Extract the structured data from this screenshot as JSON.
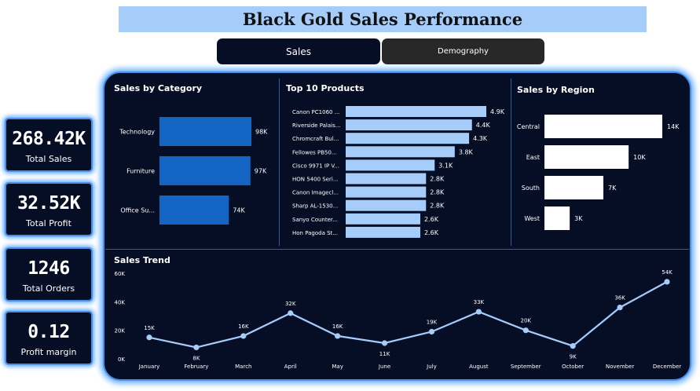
{
  "title": "Black Gold Sales Performance",
  "tabs": {
    "sales": "Sales",
    "demography": "Demography"
  },
  "kpis": [
    {
      "value": "268.42K",
      "label": "Total Sales"
    },
    {
      "value": "32.52K",
      "label": "Total Profit"
    },
    {
      "value": "1246",
      "label": "Total Orders"
    },
    {
      "value": "0.12",
      "label": "Profit margin"
    }
  ],
  "colors": {
    "category_bar": "#1464c4",
    "product_bar": "#a6ccfa",
    "region_bar": "#ffffff",
    "trend_line": "#a6ccfa",
    "panel_bg": "#060e25"
  },
  "chart_data": [
    {
      "type": "bar",
      "title": "Sales by Category",
      "orientation": "horizontal",
      "categories": [
        "Technology",
        "Furniture",
        "Office Su..."
      ],
      "values": [
        98,
        97,
        74
      ],
      "value_labels": [
        "98K",
        "97K",
        "74K"
      ]
    },
    {
      "type": "bar",
      "title": "Top 10 Products",
      "orientation": "horizontal",
      "categories": [
        "Canon PC1060 ...",
        "Riverside Palais...",
        "Chromcraft Bul...",
        "Fellowes PB50...",
        "Cisco 9971 IP V...",
        "HON 5400 Seri...",
        "Canon Imagecl...",
        "Sharp AL-1530...",
        "Sanyo Counter...",
        "Hon Pagoda St..."
      ],
      "values": [
        4.9,
        4.4,
        4.3,
        3.8,
        3.1,
        2.8,
        2.8,
        2.8,
        2.6,
        2.6
      ],
      "value_labels": [
        "4.9K",
        "4.4K",
        "4.3K",
        "3.8K",
        "3.1K",
        "2.8K",
        "2.8K",
        "2.8K",
        "2.6K",
        "2.6K"
      ]
    },
    {
      "type": "bar",
      "title": "Sales by Region",
      "orientation": "horizontal",
      "categories": [
        "Central",
        "East",
        "South",
        "West"
      ],
      "values": [
        14,
        10,
        7,
        3
      ],
      "value_labels": [
        "14K",
        "10K",
        "7K",
        "3K"
      ]
    },
    {
      "type": "line",
      "title": "Sales Trend",
      "categories": [
        "January",
        "February",
        "March",
        "April",
        "May",
        "June",
        "July",
        "August",
        "September",
        "October",
        "November",
        "December"
      ],
      "values": [
        15,
        8,
        16,
        32,
        16,
        11,
        19,
        33,
        20,
        9,
        36,
        54
      ],
      "value_labels": [
        "15K",
        "8K",
        "16K",
        "32K",
        "16K",
        "11K",
        "19K",
        "33K",
        "20K",
        "9K",
        "36K",
        "54K"
      ],
      "yticks": [
        "0K",
        "20K",
        "40K",
        "60K"
      ],
      "ylim": [
        0,
        60
      ]
    }
  ]
}
